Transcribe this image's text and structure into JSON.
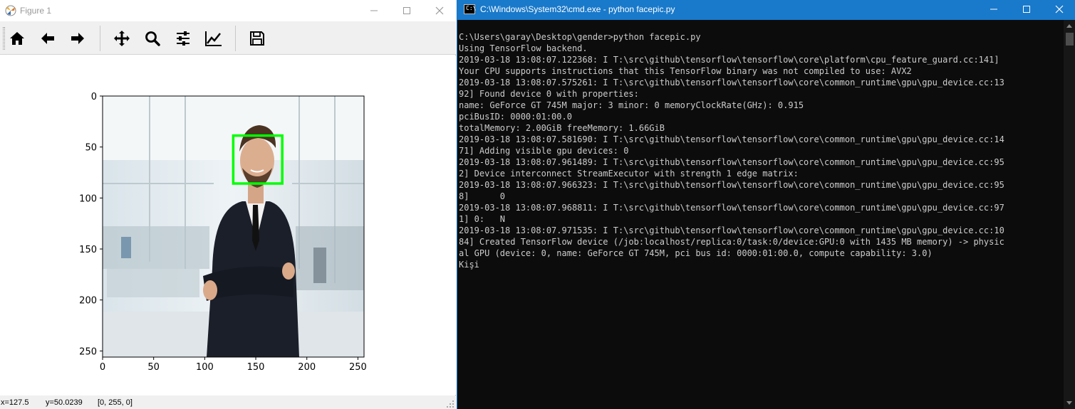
{
  "figure_window": {
    "title": "Figure 1",
    "toolbar": [
      {
        "name": "home",
        "icon": "home-icon"
      },
      {
        "name": "back",
        "icon": "arrow-left-icon"
      },
      {
        "name": "forward",
        "icon": "arrow-right-icon"
      },
      {
        "name": "pan",
        "icon": "move-icon"
      },
      {
        "name": "zoom",
        "icon": "zoom-icon"
      },
      {
        "name": "subplots",
        "icon": "sliders-icon"
      },
      {
        "name": "edit-axis",
        "icon": "line-chart-icon"
      },
      {
        "name": "save",
        "icon": "save-icon"
      }
    ],
    "plot": {
      "x_ticks": [
        "0",
        "50",
        "100",
        "150",
        "200",
        "250"
      ],
      "y_ticks": [
        "0",
        "50",
        "100",
        "150",
        "200",
        "250"
      ],
      "image_size": 256,
      "image_description": "Photo of a smiling bearded man in a dark suit and tie, arms crossed, in a bright glass office",
      "face_box": {
        "x1": 128,
        "y1": 38,
        "x2": 176,
        "y2": 85,
        "color": "#00ff00"
      }
    },
    "status": {
      "x": "x=127.5",
      "y": "y=50.0239",
      "pixel": "[0, 255, 0]"
    }
  },
  "cmd_window": {
    "title": "C:\\Windows\\System32\\cmd.exe - python  facepic.py",
    "lines": [
      "C:\\Users\\garay\\Desktop\\gender>python facepic.py",
      "Using TensorFlow backend.",
      "2019-03-18 13:08:07.122368: I T:\\src\\github\\tensorflow\\tensorflow\\core\\platform\\cpu_feature_guard.cc:141]",
      "Your CPU supports instructions that this TensorFlow binary was not compiled to use: AVX2",
      "2019-03-18 13:08:07.575261: I T:\\src\\github\\tensorflow\\tensorflow\\core\\common_runtime\\gpu\\gpu_device.cc:13",
      "92] Found device 0 with properties:",
      "name: GeForce GT 745M major: 3 minor: 0 memoryClockRate(GHz): 0.915",
      "pciBusID: 0000:01:00.0",
      "totalMemory: 2.00GiB freeMemory: 1.66GiB",
      "2019-03-18 13:08:07.581690: I T:\\src\\github\\tensorflow\\tensorflow\\core\\common_runtime\\gpu\\gpu_device.cc:14",
      "71] Adding visible gpu devices: 0",
      "2019-03-18 13:08:07.961489: I T:\\src\\github\\tensorflow\\tensorflow\\core\\common_runtime\\gpu\\gpu_device.cc:95",
      "2] Device interconnect StreamExecutor with strength 1 edge matrix:",
      "2019-03-18 13:08:07.966323: I T:\\src\\github\\tensorflow\\tensorflow\\core\\common_runtime\\gpu\\gpu_device.cc:95",
      "8]      0",
      "2019-03-18 13:08:07.968811: I T:\\src\\github\\tensorflow\\tensorflow\\core\\common_runtime\\gpu\\gpu_device.cc:97",
      "1] 0:   N",
      "2019-03-18 13:08:07.971535: I T:\\src\\github\\tensorflow\\tensorflow\\core\\common_runtime\\gpu\\gpu_device.cc:10",
      "84] Created TensorFlow device (/job:localhost/replica:0/task:0/device:GPU:0 with 1435 MB memory) -> physic",
      "al GPU (device: 0, name: GeForce GT 745M, pci bus id: 0000:01:00.0, compute capability: 3.0)",
      "Kişi"
    ]
  },
  "colors": {
    "cmd_titlebar": "#1979ca",
    "cmd_background": "#0c0c0c",
    "cmd_text": "#cccccc",
    "face_box": "#00ff00"
  }
}
